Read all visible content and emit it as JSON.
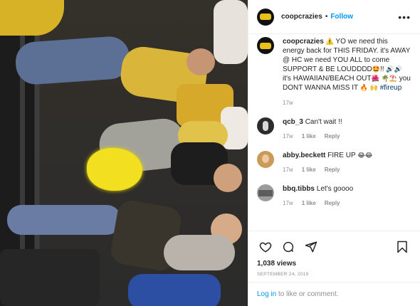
{
  "header": {
    "username": "coopcrazies",
    "separator": "•",
    "follow_label": "Follow",
    "more_icon": "more-horizontal-icon"
  },
  "caption": {
    "username": "coopcrazies",
    "text_1": "YO we need this energy back for THIS FRIDAY. it's AWAY @ HC we need YOU ALL to come SUPPORT & BE LOUDDDD",
    "text_2": "!!",
    "text_3": "it's HAWAIIAN/BEACH OUT",
    "text_4": "you DONT WANNA MISS IT",
    "hashtag": "#fireup",
    "emoji": {
      "warning": "⚠️",
      "excited": "🤩",
      "speaker_1": "🔊",
      "speaker_2": "🔊",
      "hibiscus": "🌺",
      "palm": "🌴",
      "beach": "⛱️",
      "fire": "🔥",
      "hands": "🙌"
    },
    "time": "17w"
  },
  "comments": [
    {
      "username": "qcb_3",
      "text": "Can't wait !!",
      "time": "17w",
      "likes": "1 like",
      "reply": "Reply"
    },
    {
      "username": "abby.beckett",
      "text": "FIRE UP",
      "emoji": "😂😂",
      "time": "17w",
      "likes": "1 like",
      "reply": "Reply"
    },
    {
      "username": "bbq.tibbs",
      "text": "Let's goooo",
      "time": "17w",
      "likes": "1 like",
      "reply": "Reply"
    }
  ],
  "actions": {
    "views": "1,038 views",
    "date": "SEPTEMBER 24, 2019"
  },
  "login": {
    "link": "Log in",
    "rest": " to like or comment."
  },
  "colors": {
    "accent": "#0095f6",
    "hashtag": "#00376b",
    "muted": "#8e8e8e",
    "logo_yellow": "#e8c21a"
  }
}
